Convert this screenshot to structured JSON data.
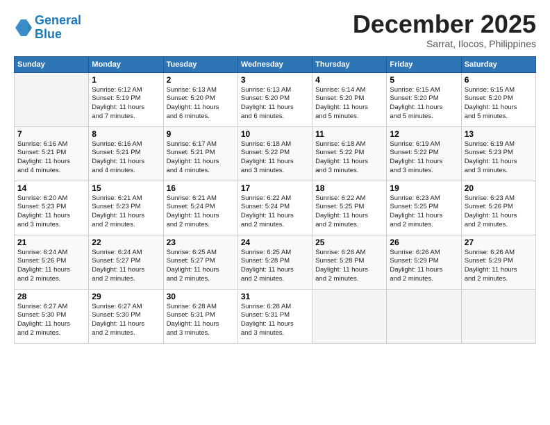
{
  "header": {
    "logo_line1": "General",
    "logo_line2": "Blue",
    "month": "December 2025",
    "location": "Sarrat, Ilocos, Philippines"
  },
  "days_of_week": [
    "Sunday",
    "Monday",
    "Tuesday",
    "Wednesday",
    "Thursday",
    "Friday",
    "Saturday"
  ],
  "weeks": [
    [
      {
        "num": "",
        "info": ""
      },
      {
        "num": "1",
        "info": "Sunrise: 6:12 AM\nSunset: 5:19 PM\nDaylight: 11 hours\nand 7 minutes."
      },
      {
        "num": "2",
        "info": "Sunrise: 6:13 AM\nSunset: 5:20 PM\nDaylight: 11 hours\nand 6 minutes."
      },
      {
        "num": "3",
        "info": "Sunrise: 6:13 AM\nSunset: 5:20 PM\nDaylight: 11 hours\nand 6 minutes."
      },
      {
        "num": "4",
        "info": "Sunrise: 6:14 AM\nSunset: 5:20 PM\nDaylight: 11 hours\nand 5 minutes."
      },
      {
        "num": "5",
        "info": "Sunrise: 6:15 AM\nSunset: 5:20 PM\nDaylight: 11 hours\nand 5 minutes."
      },
      {
        "num": "6",
        "info": "Sunrise: 6:15 AM\nSunset: 5:20 PM\nDaylight: 11 hours\nand 5 minutes."
      }
    ],
    [
      {
        "num": "7",
        "info": "Sunrise: 6:16 AM\nSunset: 5:21 PM\nDaylight: 11 hours\nand 4 minutes."
      },
      {
        "num": "8",
        "info": "Sunrise: 6:16 AM\nSunset: 5:21 PM\nDaylight: 11 hours\nand 4 minutes."
      },
      {
        "num": "9",
        "info": "Sunrise: 6:17 AM\nSunset: 5:21 PM\nDaylight: 11 hours\nand 4 minutes."
      },
      {
        "num": "10",
        "info": "Sunrise: 6:18 AM\nSunset: 5:22 PM\nDaylight: 11 hours\nand 3 minutes."
      },
      {
        "num": "11",
        "info": "Sunrise: 6:18 AM\nSunset: 5:22 PM\nDaylight: 11 hours\nand 3 minutes."
      },
      {
        "num": "12",
        "info": "Sunrise: 6:19 AM\nSunset: 5:22 PM\nDaylight: 11 hours\nand 3 minutes."
      },
      {
        "num": "13",
        "info": "Sunrise: 6:19 AM\nSunset: 5:23 PM\nDaylight: 11 hours\nand 3 minutes."
      }
    ],
    [
      {
        "num": "14",
        "info": "Sunrise: 6:20 AM\nSunset: 5:23 PM\nDaylight: 11 hours\nand 3 minutes."
      },
      {
        "num": "15",
        "info": "Sunrise: 6:21 AM\nSunset: 5:23 PM\nDaylight: 11 hours\nand 2 minutes."
      },
      {
        "num": "16",
        "info": "Sunrise: 6:21 AM\nSunset: 5:24 PM\nDaylight: 11 hours\nand 2 minutes."
      },
      {
        "num": "17",
        "info": "Sunrise: 6:22 AM\nSunset: 5:24 PM\nDaylight: 11 hours\nand 2 minutes."
      },
      {
        "num": "18",
        "info": "Sunrise: 6:22 AM\nSunset: 5:25 PM\nDaylight: 11 hours\nand 2 minutes."
      },
      {
        "num": "19",
        "info": "Sunrise: 6:23 AM\nSunset: 5:25 PM\nDaylight: 11 hours\nand 2 minutes."
      },
      {
        "num": "20",
        "info": "Sunrise: 6:23 AM\nSunset: 5:26 PM\nDaylight: 11 hours\nand 2 minutes."
      }
    ],
    [
      {
        "num": "21",
        "info": "Sunrise: 6:24 AM\nSunset: 5:26 PM\nDaylight: 11 hours\nand 2 minutes."
      },
      {
        "num": "22",
        "info": "Sunrise: 6:24 AM\nSunset: 5:27 PM\nDaylight: 11 hours\nand 2 minutes."
      },
      {
        "num": "23",
        "info": "Sunrise: 6:25 AM\nSunset: 5:27 PM\nDaylight: 11 hours\nand 2 minutes."
      },
      {
        "num": "24",
        "info": "Sunrise: 6:25 AM\nSunset: 5:28 PM\nDaylight: 11 hours\nand 2 minutes."
      },
      {
        "num": "25",
        "info": "Sunrise: 6:26 AM\nSunset: 5:28 PM\nDaylight: 11 hours\nand 2 minutes."
      },
      {
        "num": "26",
        "info": "Sunrise: 6:26 AM\nSunset: 5:29 PM\nDaylight: 11 hours\nand 2 minutes."
      },
      {
        "num": "27",
        "info": "Sunrise: 6:26 AM\nSunset: 5:29 PM\nDaylight: 11 hours\nand 2 minutes."
      }
    ],
    [
      {
        "num": "28",
        "info": "Sunrise: 6:27 AM\nSunset: 5:30 PM\nDaylight: 11 hours\nand 2 minutes."
      },
      {
        "num": "29",
        "info": "Sunrise: 6:27 AM\nSunset: 5:30 PM\nDaylight: 11 hours\nand 2 minutes."
      },
      {
        "num": "30",
        "info": "Sunrise: 6:28 AM\nSunset: 5:31 PM\nDaylight: 11 hours\nand 3 minutes."
      },
      {
        "num": "31",
        "info": "Sunrise: 6:28 AM\nSunset: 5:31 PM\nDaylight: 11 hours\nand 3 minutes."
      },
      {
        "num": "",
        "info": ""
      },
      {
        "num": "",
        "info": ""
      },
      {
        "num": "",
        "info": ""
      }
    ]
  ]
}
